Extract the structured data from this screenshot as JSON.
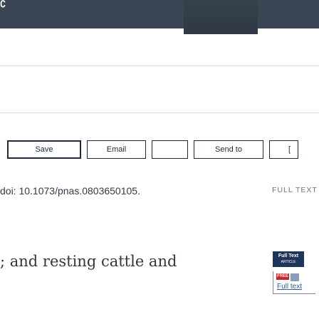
{
  "header": {
    "brand_glyph": "∁"
  },
  "toolbar": {
    "save_label": "Save",
    "email_label": "Email",
    "send_to_label": "Send to",
    "more_label": "["
  },
  "article": {
    "doi": "doi: 10.1073/pnas.0803650105.",
    "title_fragment": "; and resting cattle and"
  },
  "sidebar": {
    "full_text_heading": "FULL TEXT",
    "publisher_badge_title": "Full Text",
    "publisher_badge_sub": "ARTICLE",
    "free_tag": "FREE",
    "pmc_link": "Full text"
  },
  "colors": {
    "header_bg": "#3b4553",
    "toolbar_border": "#1f2a38",
    "link": "#2c5aa0",
    "free_tag": "#c62828"
  }
}
